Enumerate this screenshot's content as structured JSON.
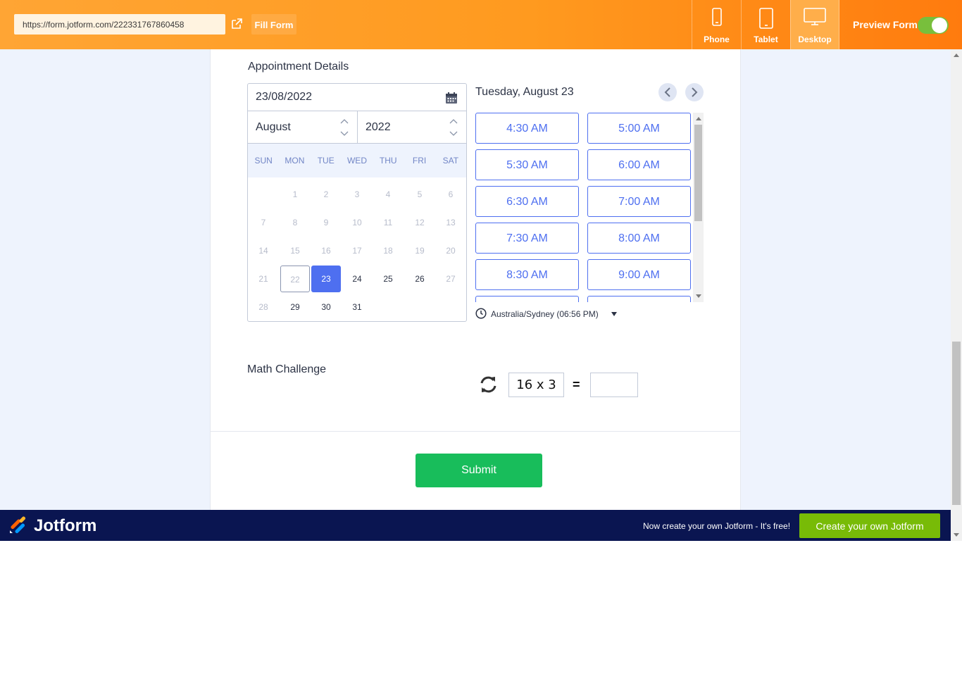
{
  "topbar": {
    "url": "https://form.jotform.com/222331767860458",
    "fill_form_label": "Fill Form",
    "devices": [
      {
        "label": "Phone",
        "icon": "phone-icon",
        "active": false
      },
      {
        "label": "Tablet",
        "icon": "tablet-icon",
        "active": false
      },
      {
        "label": "Desktop",
        "icon": "desktop-icon",
        "active": true
      }
    ],
    "preview_label": "Preview Form",
    "preview_on": true
  },
  "appointment": {
    "label": "Appointment Details",
    "date_value": "23/08/2022",
    "month": "August",
    "year": "2022",
    "weekdays": [
      "SUN",
      "MON",
      "TUE",
      "WED",
      "THU",
      "FRI",
      "SAT"
    ],
    "weeks": [
      [
        "",
        "1",
        "2",
        "3",
        "4",
        "5",
        "6"
      ],
      [
        "7",
        "8",
        "9",
        "10",
        "11",
        "12",
        "13"
      ],
      [
        "14",
        "15",
        "16",
        "17",
        "18",
        "19",
        "20"
      ],
      [
        "21",
        "22",
        "23",
        "24",
        "25",
        "26",
        "27"
      ],
      [
        "28",
        "29",
        "30",
        "31",
        "",
        "",
        ""
      ]
    ],
    "today": "22",
    "selected": "23",
    "available": [
      "24",
      "25",
      "26",
      "29",
      "30",
      "31"
    ],
    "slot_date": "Tuesday, August 23",
    "slots": [
      "4:30 AM",
      "5:00 AM",
      "5:30 AM",
      "6:00 AM",
      "6:30 AM",
      "7:00 AM",
      "7:30 AM",
      "8:00 AM",
      "8:30 AM",
      "9:00 AM",
      "",
      ""
    ],
    "timezone": "Australia/Sydney (06:56 PM)"
  },
  "math": {
    "label": "Math Challenge",
    "question": "16 x 3",
    "equals": "=",
    "answer": ""
  },
  "submit_label": "Submit",
  "banner": {
    "brand": "Jotform",
    "message": "Now create your own Jotform - It's free!",
    "cta": "Create your own Jotform"
  },
  "colors": {
    "accent": "#4e6ff0",
    "submit": "#18bd5b",
    "banner": "#0a1551",
    "cta": "#78bb07",
    "topbar": "#ff9a1f"
  }
}
